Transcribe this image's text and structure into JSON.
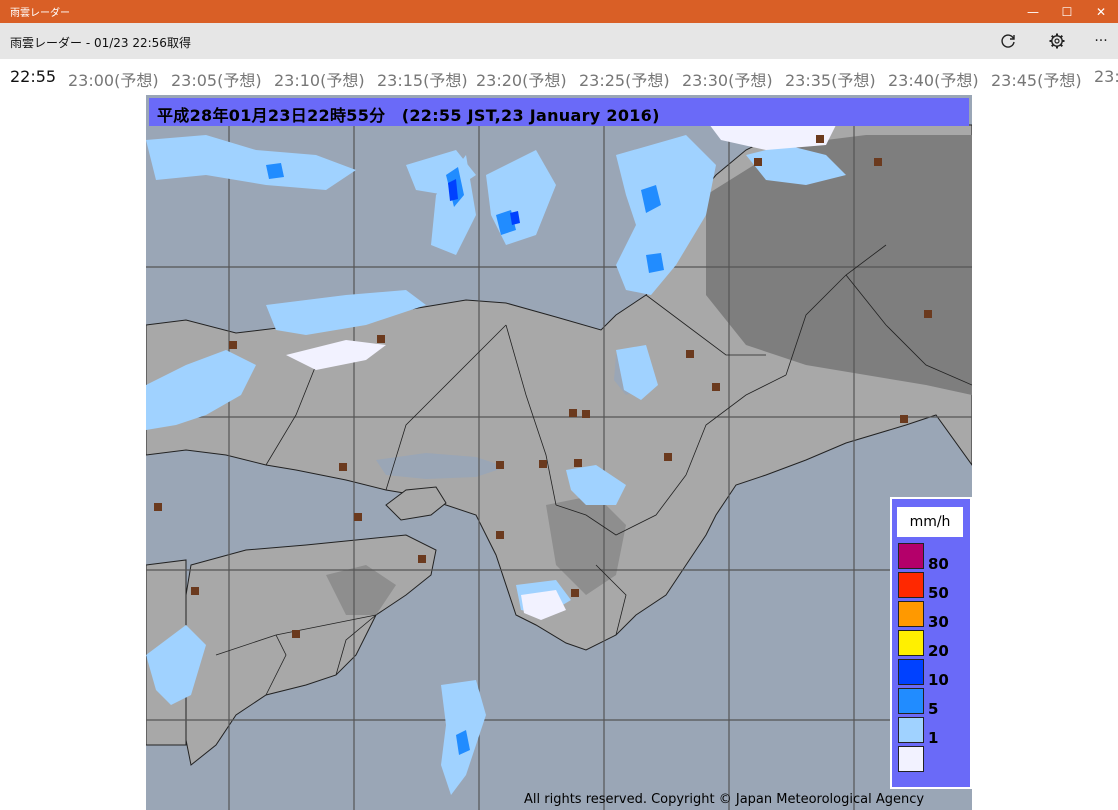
{
  "window": {
    "title": "雨雲レーダー",
    "minimize": "—",
    "maximize": "☐",
    "close": "✕"
  },
  "app": {
    "title": "雨雲レーダー - 01/23 22:56取得",
    "refresh_icon": "refresh-icon",
    "settings_icon": "gear-icon",
    "more_label": "···"
  },
  "times": [
    "22:55",
    "23:00(予想)",
    "23:05(予想)",
    "23:10(予想)",
    "23:15(予想)",
    "23:20(予想)",
    "23:25(予想)",
    "23:30(予想)",
    "23:35(予想)",
    "23:40(予想)",
    "23:45(予想)",
    "23:5"
  ],
  "selected_time_index": 0,
  "radar": {
    "header": "平成28年01月23日22時55分　(22:55 JST,23 January 2016)",
    "copyright": "All rights reserved. Copyright © Japan Meteorological Agency",
    "legend": {
      "unit": "mm/h",
      "items": [
        {
          "label": "80",
          "color": "#b4006a"
        },
        {
          "label": "50",
          "color": "#ff2800"
        },
        {
          "label": "30",
          "color": "#ff9900"
        },
        {
          "label": "20",
          "color": "#fff000"
        },
        {
          "label": "10",
          "color": "#0041ff"
        },
        {
          "label": "5",
          "color": "#218cff"
        },
        {
          "label": "1",
          "color": "#a0d2ff"
        },
        {
          "label": "",
          "color": "#f2f2ff"
        }
      ]
    }
  },
  "colors": {
    "titlebar": "#d95f26",
    "sea": "#9aa6b6",
    "land": "#a8a8a8",
    "mountain": "#7e7e7e",
    "rain_light": "#a0d2ff",
    "rain_med": "#218cff",
    "city_marker": "#6b3a1e"
  }
}
